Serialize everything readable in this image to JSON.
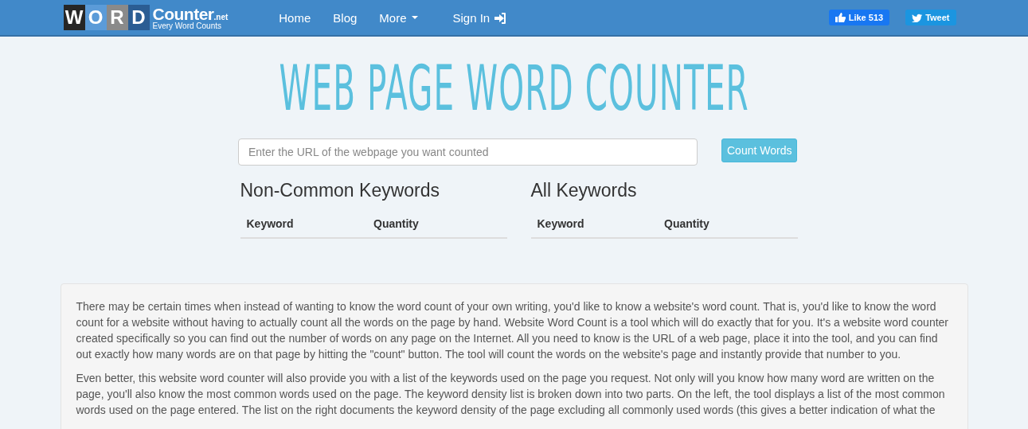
{
  "navbar": {
    "logo": {
      "letters": [
        {
          "text": "W",
          "color": "#262626"
        },
        {
          "text": "O",
          "color": "#5b9bd8"
        },
        {
          "text": "R",
          "color": "#8a8a8a"
        },
        {
          "text": "D",
          "color": "#2b5d93"
        }
      ],
      "name": "Counter",
      "tld": ".net",
      "tagline": "Every Word Counts"
    },
    "links": [
      {
        "label": "Home",
        "kind": "link"
      },
      {
        "label": "Blog",
        "kind": "link"
      },
      {
        "label": "More",
        "kind": "dropdown"
      },
      {
        "label": "Sign In",
        "kind": "signin"
      }
    ],
    "social": [
      {
        "kind": "like",
        "label": "Like 513"
      },
      {
        "kind": "tweet",
        "label": "Tweet"
      }
    ]
  },
  "title": "WEB PAGE WORD COUNTER",
  "search": {
    "placeholder": "Enter the URL of the webpage you want counted",
    "button": "Count Words"
  },
  "keyword_tables": [
    {
      "title": "Non-Common Keywords",
      "columns": [
        "Keyword",
        "Quantity"
      ]
    },
    {
      "title": "All Keywords",
      "columns": [
        "Keyword",
        "Quantity"
      ]
    }
  ],
  "article": {
    "paragraphs": [
      "There may be certain times when instead of wanting to know the word count of your own writing, you'd like to know a website's word count. That is, you'd like to know the word count for a website without having to actually count all the words on the page by hand. Website Word Count is a tool which will do exactly that for you. It's a website word counter created specifically so you can find out the number of words on any page on the Internet. All you need to know is the URL of a web page, place it into the tool, and you can find out exactly how many words are on that page by hitting the \"count\" button. The tool will count the words on the website's page and instantly provide that number to you.",
      "Even better, this website word counter will also provide you with a list of the keywords used on the page you request. Not only will you know how many word are written on the page, you'll also know the most common words used on the page. The keyword density list is broken down into two parts. On the left, the tool displays a list of the most common words used on the page entered. The list on the right documents the keyword density of the page excluding all commonly used words (this gives a better indication of what the"
    ]
  }
}
